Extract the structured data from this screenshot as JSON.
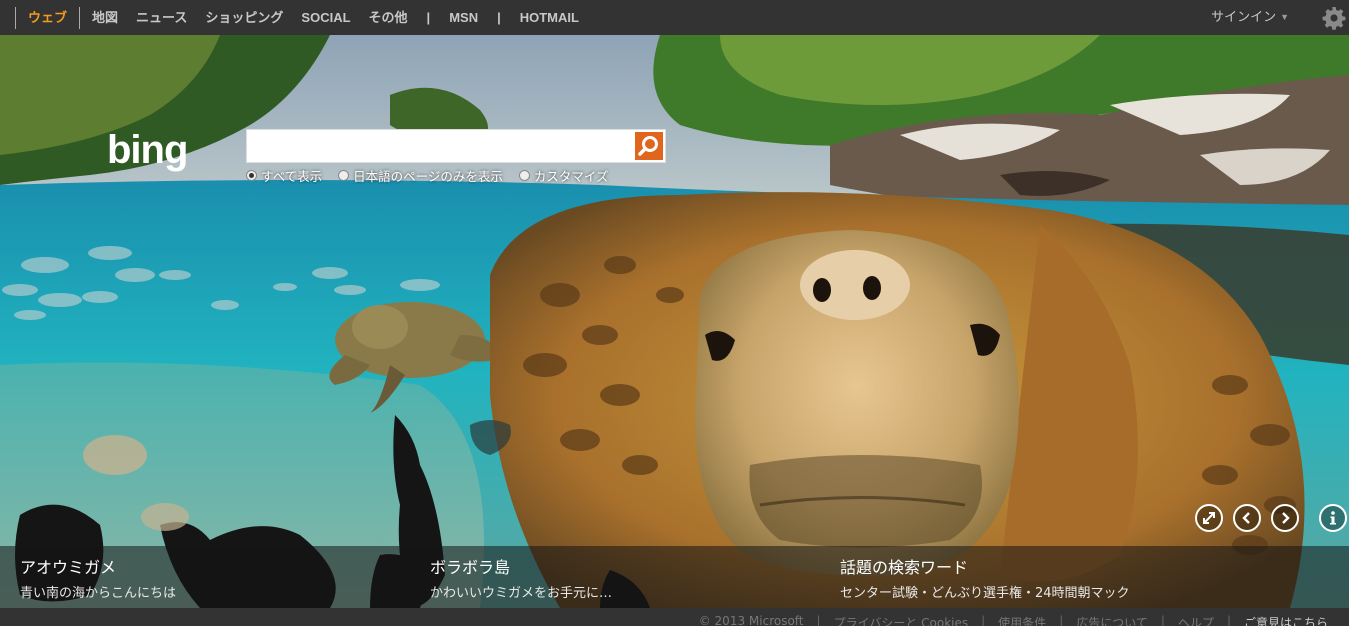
{
  "nav": {
    "items": [
      {
        "label": "ウェブ",
        "active": true
      },
      {
        "label": "地図"
      },
      {
        "label": "ニュース"
      },
      {
        "label": "ショッピング"
      },
      {
        "label": "SOCIAL"
      },
      {
        "label": "その他"
      },
      {
        "label": "MSN"
      },
      {
        "label": "HOTMAIL"
      }
    ],
    "separator": "|",
    "signin_label": "サインイン",
    "signin_icon": "chevron-down-icon",
    "settings_icon": "gear-icon"
  },
  "search": {
    "logo_text": "bing",
    "value": "",
    "placeholder": "",
    "button_icon": "search-icon",
    "scopes": [
      {
        "label": "すべて表示",
        "selected": true
      },
      {
        "label": "日本語のページのみを表示",
        "selected": false
      },
      {
        "label": "カスタマイズ",
        "selected": false
      }
    ]
  },
  "controls": [
    "expand-icon",
    "previous-icon",
    "next-icon",
    "info-icon"
  ],
  "hotspots": [
    {
      "title": "アオウミガメ",
      "subtitle": "青い南の海からこんにちは"
    },
    {
      "title": "ボラボラ島",
      "subtitle": "かわいいウミガメをお手元に…"
    },
    {
      "title": "話題の検索ワード",
      "subtitle": "センター試験・どんぶり選手権・24時間朝マック"
    }
  ],
  "footer": {
    "links": [
      "© 2013 Microsoft",
      "プライバシーと Cookies",
      "使用条件",
      "広告について",
      "ヘルプ",
      "ご意見はこちら"
    ]
  },
  "colors": {
    "accent": "#f39c1f",
    "search_button": "#e0661d",
    "topbar": "#333333"
  }
}
